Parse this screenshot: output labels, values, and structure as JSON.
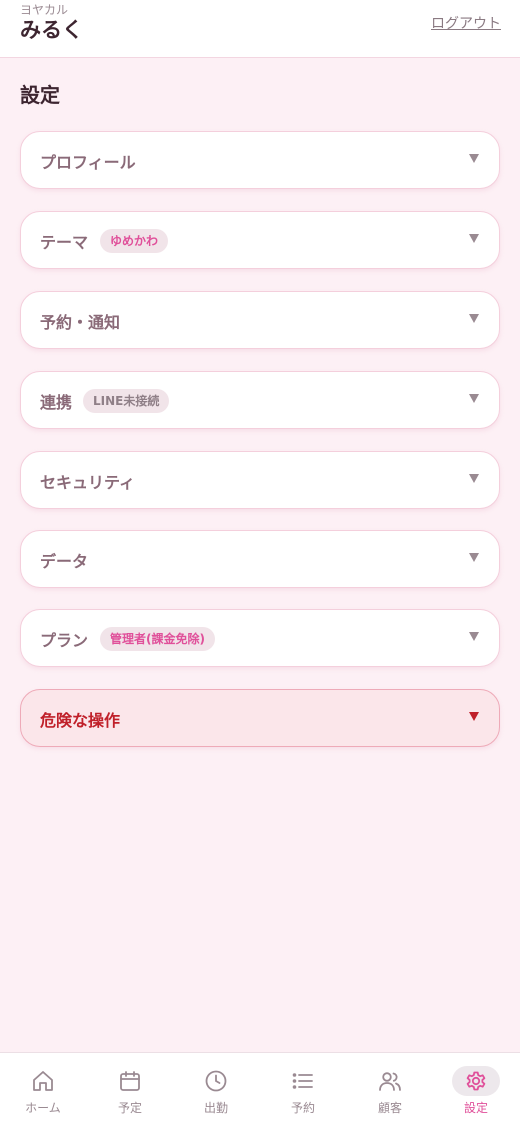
{
  "header": {
    "store_name": "ヨヤカル",
    "user_name": "みるく",
    "logout_label": "ログアウト"
  },
  "page": {
    "title": "設定"
  },
  "sections": [
    {
      "label": "プロフィール"
    },
    {
      "label": "テーマ",
      "badge": "ゆめかわ"
    },
    {
      "label": "予約・通知"
    },
    {
      "label": "連携",
      "badge": "LINE未接続"
    },
    {
      "label": "セキュリティ"
    },
    {
      "label": "データ"
    },
    {
      "label": "プラン",
      "badge": "管理者(課金免除)"
    },
    {
      "label": "危険な操作"
    }
  ],
  "bottom_nav": {
    "items": [
      {
        "label": "ホーム",
        "icon": "home-icon"
      },
      {
        "label": "予定",
        "icon": "calendar-icon"
      },
      {
        "label": "出勤",
        "icon": "clock-icon"
      },
      {
        "label": "予約",
        "icon": "list-icon"
      },
      {
        "label": "顧客",
        "icon": "users-icon"
      },
      {
        "label": "設定",
        "icon": "gear-icon",
        "active": true
      }
    ]
  },
  "colors": {
    "accent": "#e0509a",
    "background": "#fdf0f5",
    "danger": "#c0202a"
  }
}
